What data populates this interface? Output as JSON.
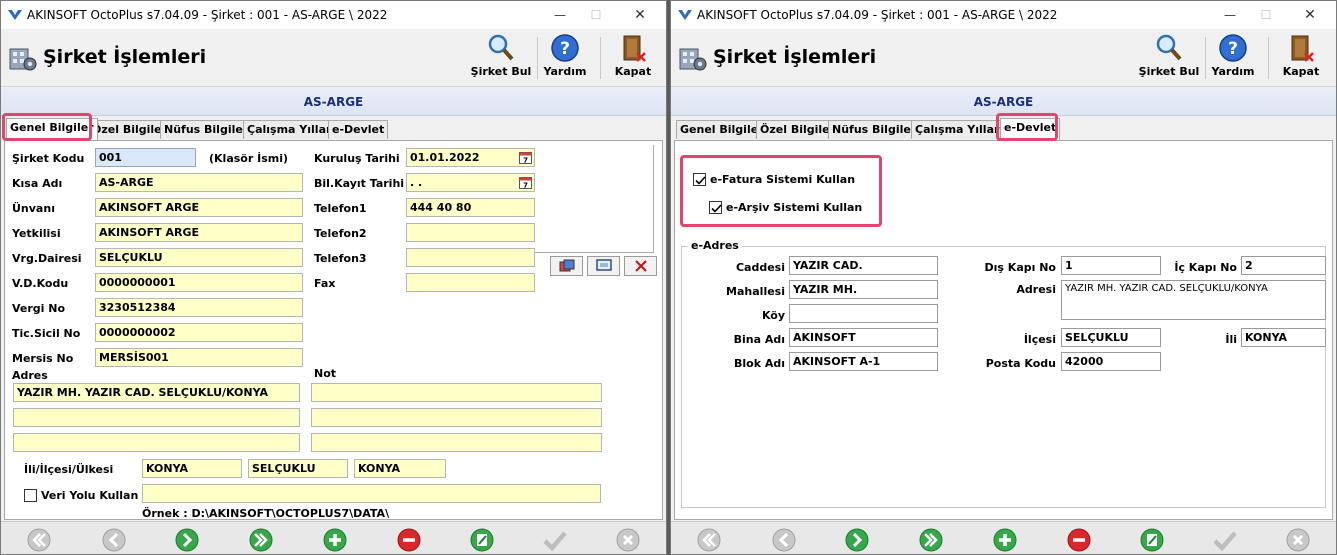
{
  "colors": {
    "field_yellow": "#ffffc8",
    "highlight": "#e0466e",
    "company_band_text": "#1a2f7a"
  },
  "window_left": {
    "title": "AKINSOFT OctoPlus s7.04.09  -  Şirket : 001 - AS-ARGE \\ 2022",
    "header_title": "Şirket İşlemleri",
    "toolbar": {
      "find": "Şirket Bul",
      "help": "Yardım",
      "close": "Kapat"
    },
    "company": "AS-ARGE",
    "tabs": [
      "Genel Bilgiler",
      "Özel Bilgiler",
      "Nüfus Bilgileri",
      "Çalışma Yılları",
      "e-Devlet"
    ],
    "active_tab": "Genel Bilgiler",
    "general": {
      "company_code_label": "Şirket Kodu",
      "company_code": "001",
      "folder_name_label": "(Klasör İsmi)",
      "short_name_label": "Kısa Adı",
      "short_name": "AS-ARGE",
      "title_label": "Ünvanı",
      "title": "AKINSOFT ARGE",
      "authority_label": "Yetkilisi",
      "authority": "AKINSOFT ARGE",
      "tax_office_label": "Vrg.Dairesi",
      "tax_office": "SELÇUKLU",
      "tax_office_code_label": "V.D.Kodu",
      "tax_office_code": "0000000001",
      "tax_no_label": "Vergi No",
      "tax_no": "3230512384",
      "trade_reg_label": "Tic.Sicil No",
      "trade_reg": "0000000002",
      "mersis_label": "Mersis No",
      "mersis": "MERSİS001",
      "founded_label": "Kuruluş Tarihi",
      "founded": "01.01.2022",
      "bil_date_label": "Bil.Kayıt Tarihi",
      "bil_date": ". .",
      "phone1_label": "Telefon1",
      "phone1": "444 40 80",
      "phone2_label": "Telefon2",
      "phone2": "",
      "phone3_label": "Telefon3",
      "phone3": "",
      "fax_label": "Fax",
      "fax": "",
      "address_label": "Adres",
      "address_lines": [
        "YAZIR MH. YAZIR CAD. SELÇUKLU/KONYA",
        "",
        ""
      ],
      "note_label": "Not",
      "note_lines": [
        "",
        "",
        ""
      ],
      "city_label": "İli/İlçesi/Ülkesi",
      "city": "KONYA",
      "district": "SELÇUKLU",
      "country": "KONYA",
      "data_path_label": "Veri Yolu Kullan",
      "data_path_checked": false,
      "data_path": "",
      "example_text": "Örnek : D:\\AKINSOFT\\OCTOPLUS7\\DATA\\"
    }
  },
  "window_right": {
    "title": "AKINSOFT OctoPlus s7.04.09  -  Şirket : 001 - AS-ARGE \\ 2022",
    "header_title": "Şirket İşlemleri",
    "toolbar": {
      "find": "Şirket Bul",
      "help": "Yardım",
      "close": "Kapat"
    },
    "company": "AS-ARGE",
    "tabs": [
      "Genel Bilgiler",
      "Özel Bilgiler",
      "Nüfus Bilgileri",
      "Çalışma Yılları",
      "e-Devlet"
    ],
    "active_tab": "e-Devlet",
    "edevlet": {
      "efatura_label": "e-Fatura Sistemi Kullan",
      "efatura_checked": true,
      "earsiv_label": "e-Arşiv Sistemi Kullan",
      "earsiv_checked": true,
      "eadres_title": "e-Adres",
      "street_label": "Caddesi",
      "street": "YAZIR CAD.",
      "outer_door_label": "Dış Kapı No",
      "outer_door": "1",
      "inner_door_label": "İç Kapı No",
      "inner_door": "2",
      "neighborhood_label": "Mahallesi",
      "neighborhood": "YAZIR MH.",
      "address_label": "Adresi",
      "address": "YAZIR MH. YAZIR CAD. SELÇUKLU/KONYA",
      "village_label": "Köy",
      "village": "",
      "building_label": "Bina Adı",
      "building": "AKINSOFT",
      "district_label": "İlçesi",
      "district": "SELÇUKLU",
      "city_label": "İli",
      "city": "KONYA",
      "block_label": "Blok Adı",
      "block": "AKINSOFT A-1",
      "postal_label": "Posta Kodu",
      "postal": "42000"
    }
  }
}
